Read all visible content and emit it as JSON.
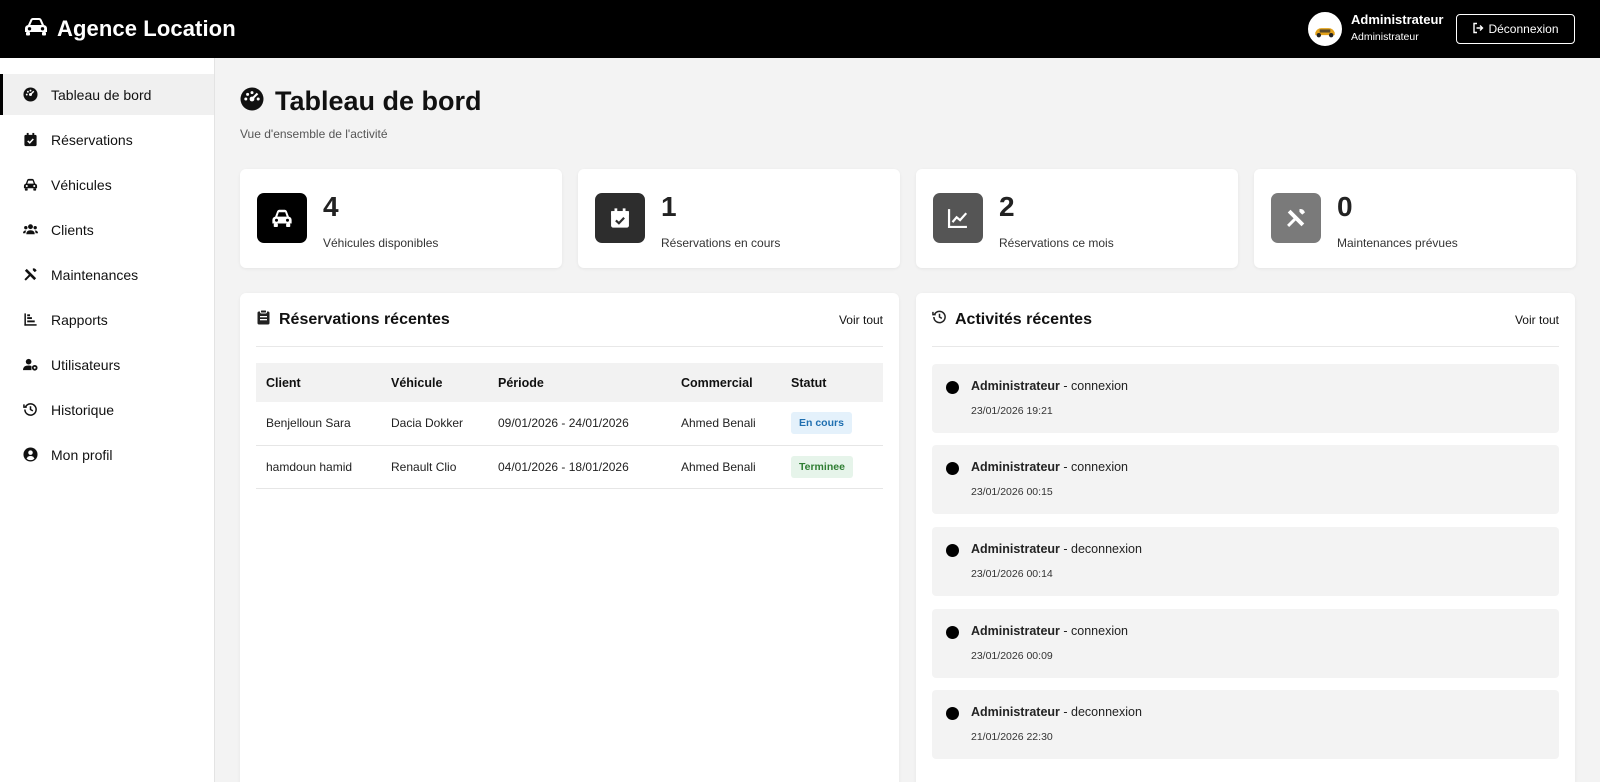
{
  "header": {
    "brand": "Agence Location",
    "user_name": "Administrateur",
    "user_role": "Administrateur",
    "logout_label": "Déconnexion"
  },
  "sidebar": {
    "items": [
      {
        "label": "Tableau de bord",
        "icon": "dashboard-icon",
        "active": true
      },
      {
        "label": "Réservations",
        "icon": "calendar-check-icon"
      },
      {
        "label": "Véhicules",
        "icon": "car-icon"
      },
      {
        "label": "Clients",
        "icon": "users-icon"
      },
      {
        "label": "Maintenances",
        "icon": "tools-icon"
      },
      {
        "label": "Rapports",
        "icon": "chart-bar-icon"
      },
      {
        "label": "Utilisateurs",
        "icon": "user-cog-icon"
      },
      {
        "label": "Historique",
        "icon": "history-icon"
      },
      {
        "label": "Mon profil",
        "icon": "user-circle-icon"
      }
    ]
  },
  "page": {
    "title": "Tableau de bord",
    "subtitle": "Vue d'ensemble de l'activité"
  },
  "stats": [
    {
      "value": "4",
      "label": "Véhicules disponibles",
      "icon": "car-icon",
      "color": "#000000"
    },
    {
      "value": "1",
      "label": "Réservations en cours",
      "icon": "calendar-check-icon",
      "color": "#2d2d2d"
    },
    {
      "value": "2",
      "label": "Réservations ce mois",
      "icon": "chart-line-icon",
      "color": "#555555"
    },
    {
      "value": "0",
      "label": "Maintenances prévues",
      "icon": "tools-icon",
      "color": "#7a7a7a"
    }
  ],
  "reservations": {
    "title": "Réservations récentes",
    "link": "Voir tout",
    "columns": [
      "Client",
      "Véhicule",
      "Période",
      "Commercial",
      "Statut"
    ],
    "rows": [
      {
        "client": "Benjelloun Sara",
        "vehicle": "Dacia Dokker",
        "period": "09/01/2026 - 24/01/2026",
        "commercial": "Ahmed Benali",
        "status": "En cours"
      },
      {
        "client": "hamdoun hamid",
        "vehicle": "Renault Clio",
        "period": "04/01/2026 - 18/01/2026",
        "commercial": "Ahmed Benali",
        "status": "Terminee"
      }
    ]
  },
  "activities": {
    "title": "Activités récentes",
    "link": "Voir tout",
    "items": [
      {
        "user": "Administrateur",
        "action": " - connexion",
        "time": "23/01/2026 19:21"
      },
      {
        "user": "Administrateur",
        "action": " - connexion",
        "time": "23/01/2026 00:15"
      },
      {
        "user": "Administrateur",
        "action": " - deconnexion",
        "time": "23/01/2026 00:14"
      },
      {
        "user": "Administrateur",
        "action": " - connexion",
        "time": "23/01/2026 00:09"
      },
      {
        "user": "Administrateur",
        "action": " - deconnexion",
        "time": "21/01/2026 22:30"
      }
    ]
  }
}
